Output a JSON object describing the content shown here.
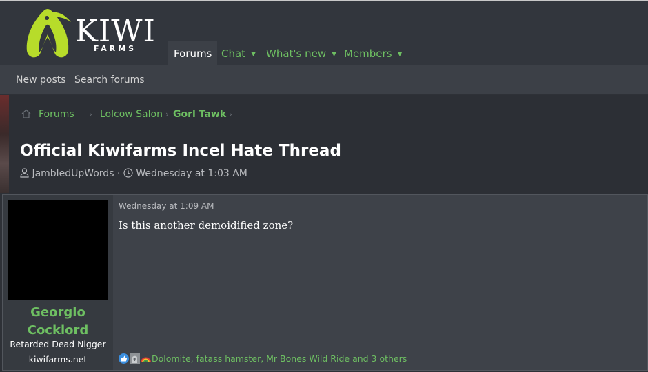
{
  "logo": {
    "word": "KIWI",
    "sub": "FARMS"
  },
  "nav": {
    "tabs": [
      {
        "label": "Forums",
        "active": true
      },
      {
        "label": "Chat",
        "dropdown": true
      },
      {
        "label": "What's new",
        "dropdown": true
      },
      {
        "label": "Members",
        "dropdown": true
      }
    ]
  },
  "subnav": {
    "new_posts": "New posts",
    "search_forums": "Search forums"
  },
  "breadcrumb": {
    "items": [
      "Forums",
      "Lolcow Salon",
      "Gorl Tawk"
    ],
    "separator": "›"
  },
  "thread": {
    "title": "Official Kiwifarms Incel Hate Thread",
    "author": "JambledUpWords",
    "separator": "·",
    "date": "Wednesday at 1:03 AM"
  },
  "post": {
    "date": "Wednesday at 1:09 AM",
    "body": "Is this another demoidified zone?",
    "user": {
      "name_line1": "Georgio",
      "name_line2": "Cocklord",
      "title": "Retarded Dead Nigger",
      "site": "kiwifarms.net"
    },
    "reactions": {
      "icons": [
        "thumbs-up-icon",
        "tombstone-icon",
        "rainbow-icon"
      ],
      "text": "Dolomite, fatass hamster, Mr Bones Wild Ride and 3 others"
    }
  },
  "colors": {
    "accent": "#6ebf62",
    "header": "#32363d",
    "subnav": "#3c4047",
    "post_bg": "#3e4249"
  }
}
